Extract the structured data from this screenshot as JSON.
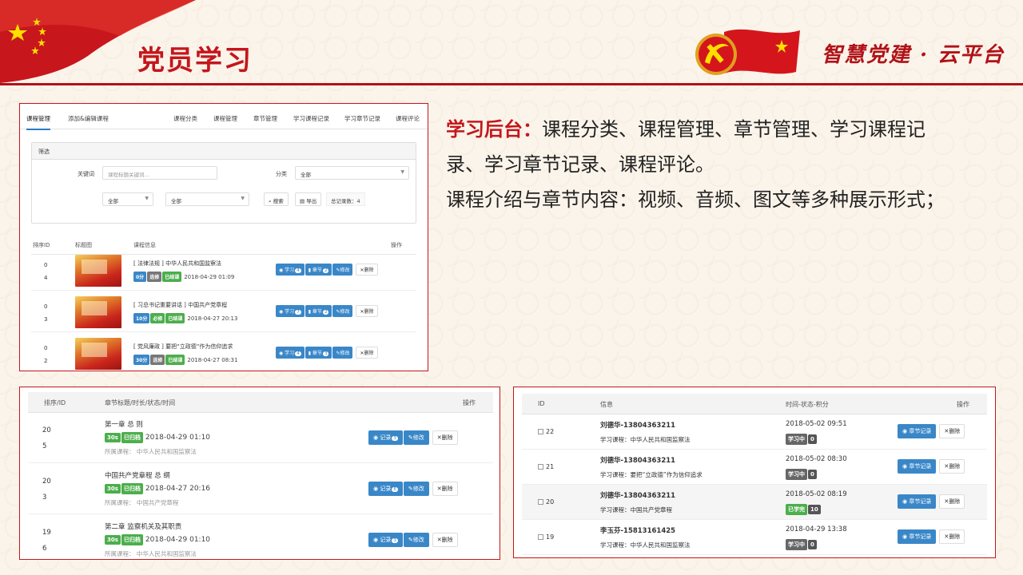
{
  "header": {
    "title": "党员学习",
    "brand": "智慧党建 · 云平台"
  },
  "description": {
    "line1_highlight": "学习后台：",
    "line1_rest": "课程分类、课程管理、章节管理、学习课程记",
    "line2": "录、学习章节记录、课程评论。",
    "line3": "课程介绍与章节内容：视频、音频、图文等多种展示形式；"
  },
  "course_panel": {
    "tabs": [
      "课程管理",
      "添加&编辑课程",
      "课程分类",
      "课程管理",
      "章节管理",
      "学习课程记录",
      "学习章节记录",
      "课程评论"
    ],
    "filter": {
      "heading": "筛选",
      "keyword_label": "关键词",
      "keyword_placeholder": "课程标题关键词...",
      "category_label": "分类",
      "category_value": "全部",
      "select1_value": "全部",
      "select2_value": "全部",
      "search_label": "搜索",
      "export_label": "导出",
      "total_label": "总记录数：4"
    },
    "columns": [
      "排序ID",
      "标题图",
      "课程信息",
      "操作"
    ],
    "rows": [
      {
        "sort": "0",
        "id": "4",
        "title": "[ 法律法规 ] 中华人民共和国监察法",
        "score": "0分",
        "type": "选修",
        "status": "已结课",
        "date": "2018-04-29 01:09",
        "study_count": "4",
        "chapter_count": "2"
      },
      {
        "sort": "0",
        "id": "3",
        "title": "[ 习总书记重要讲话 ] 中国共产党章程",
        "score": "10分",
        "type": "必修",
        "status": "已结课",
        "date": "2018-04-27 20:13",
        "study_count": "7",
        "chapter_count": "2"
      },
      {
        "sort": "0",
        "id": "2",
        "title": "[ 党风廉政 ] 要把“立政德”作为信仰追求",
        "score": "30分",
        "type": "选修",
        "status": "已结课",
        "date": "2018-04-27 08:31",
        "study_count": "4",
        "chapter_count": "3"
      }
    ],
    "btn_study": "学习",
    "btn_chapter": "章节",
    "btn_edit": "修改",
    "btn_delete": "删除"
  },
  "chapter_panel": {
    "columns": [
      "排序/ID",
      "章节标题/时长/状态/时间",
      "操作"
    ],
    "rows": [
      {
        "sort": "20",
        "id": "5",
        "title": "第一章 总 则",
        "duration": "30s",
        "status": "已归档",
        "date": "2018-04-29 01:10",
        "course": "所属课程：  中华人民共和国监察法",
        "record_count": "3"
      },
      {
        "sort": "20",
        "id": "3",
        "title": "中国共产党章程 总 纲",
        "duration": "30s",
        "status": "已归档",
        "date": "2018-04-27 20:16",
        "course": "所属课程：  中国共产党章程",
        "record_count": "6"
      },
      {
        "sort": "19",
        "id": "6",
        "title": "第二章  监察机关及其职责",
        "duration": "30s",
        "status": "已归档",
        "date": "2018-04-29 01:10",
        "course": "所属课程：  中华人民共和国监察法",
        "record_count": "3"
      }
    ],
    "btn_record": "记录",
    "btn_edit": "修改",
    "btn_delete": "删除"
  },
  "record_panel": {
    "columns": [
      "ID",
      "信息",
      "时间-状态-积分",
      "操作"
    ],
    "rows": [
      {
        "id": "22",
        "name": "刘德华-13804363211",
        "course": "学习课程：中华人民共和国监察法",
        "time": "2018-05-02 09:51",
        "status": "学习中",
        "points": "0"
      },
      {
        "id": "21",
        "name": "刘德华-13804363211",
        "course": "学习课程：要把“立政德”作为信仰追求",
        "time": "2018-05-02 08:30",
        "status": "学习中",
        "points": "0"
      },
      {
        "id": "20",
        "name": "刘德华-13804363211",
        "course": "学习课程：中国共产党章程",
        "time": "2018-05-02 08:19",
        "status": "已学完",
        "points": "10"
      },
      {
        "id": "19",
        "name": "李玉芬-15813161425",
        "course": "学习课程：中华人民共和国监察法",
        "time": "2018-04-29 13:38",
        "status": "学习中",
        "points": "0"
      }
    ],
    "btn_chapter_record": "章节记录",
    "btn_delete": "删除"
  }
}
